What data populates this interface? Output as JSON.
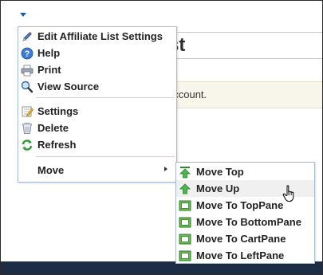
{
  "background": {
    "title_fragment": "st",
    "message_fragment": "account."
  },
  "menu": {
    "items": [
      {
        "label": "Edit Affiliate List Settings",
        "icon": "pencil-icon"
      },
      {
        "label": "Help",
        "icon": "help-icon"
      },
      {
        "label": "Print",
        "icon": "printer-icon"
      },
      {
        "label": "View Source",
        "icon": "magnifier-icon"
      },
      {
        "label": "Settings",
        "icon": "settings-icon"
      },
      {
        "label": "Delete",
        "icon": "trash-icon"
      },
      {
        "label": "Refresh",
        "icon": "refresh-icon"
      },
      {
        "label": "Move",
        "icon": "submenu-arrow-icon"
      }
    ]
  },
  "submenu": {
    "items": [
      {
        "label": "Move Top",
        "icon": "move-top-icon"
      },
      {
        "label": "Move Up",
        "icon": "move-up-icon"
      },
      {
        "label": "Move To TopPane",
        "icon": "pane-icon"
      },
      {
        "label": "Move To BottomPane",
        "icon": "pane-icon"
      },
      {
        "label": "Move To CartPane",
        "icon": "pane-icon"
      },
      {
        "label": "Move To LeftPane",
        "icon": "pane-icon"
      }
    ],
    "hovered": "Move Up"
  },
  "colors": {
    "accent": "#1b5da8",
    "menu_border": "#a7bad0",
    "footer": "#1c2d45",
    "pane_icon_green": "#3a9a2f"
  }
}
